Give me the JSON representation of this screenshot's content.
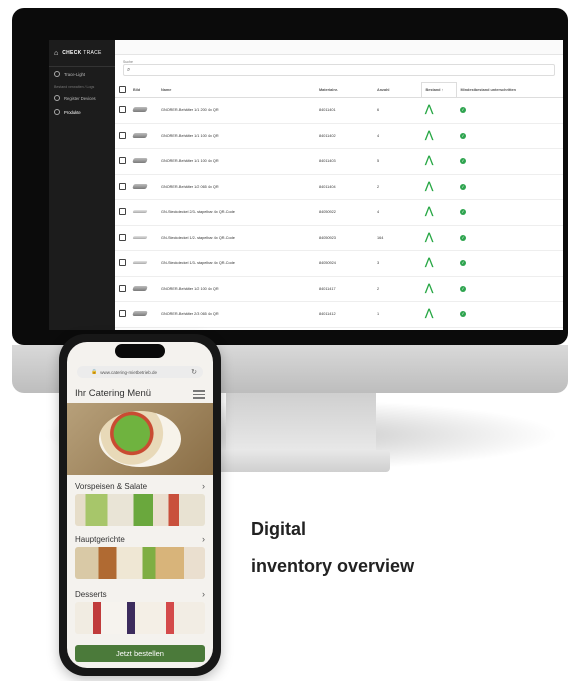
{
  "app": {
    "brand_prefix": "CHECK",
    "brand_suffix": "TRACE",
    "sidebar_items": [
      {
        "label": "Trace-Light"
      },
      {
        "label": "Register Devices"
      },
      {
        "label": "Produkte"
      }
    ],
    "sidebar_section": "Bestand verwalten / Logs",
    "search_label": "Suche",
    "table": {
      "columns": [
        "Bild",
        "Name",
        "Materialnr.",
        "Anzahl",
        "Bestand",
        "Mindestbestand unterschritten"
      ],
      "rows": [
        {
          "name": "GNORER-Behälter 1/1 200 4x QR",
          "material": "84011401",
          "count": "6"
        },
        {
          "name": "GNORER-Behälter 1/1 100 4x QR",
          "material": "84011402",
          "count": "4"
        },
        {
          "name": "GNORER-Behälter 1/1 100 4x QR",
          "material": "84011403",
          "count": "5"
        },
        {
          "name": "GNORER-Behälter 1/2 065 4x QR",
          "material": "84011404",
          "count": "2"
        },
        {
          "name": "GN-Steckdeckel 2/3- stapelbar 4x QR-Code",
          "material": "84050922",
          "count": "4"
        },
        {
          "name": "GN-Steckdeckel 1/2- stapelbar 4x QR-Code",
          "material": "84050923",
          "count": "164"
        },
        {
          "name": "GN-Steckdeckel 1/3- stapelbar 4x QR-Code",
          "material": "84050924",
          "count": "3"
        },
        {
          "name": "GNORER-Behälter 1/2 100 4x QR",
          "material": "84011417",
          "count": "2"
        },
        {
          "name": "GNORER-Behälter 2/3 065 4x QR",
          "material": "84011412",
          "count": "1"
        }
      ]
    }
  },
  "phone": {
    "url": "www.catering-mietbetrieb.de",
    "menu_title": "Ihr Catering Menü",
    "categories": [
      {
        "label": "Vorspeisen & Salate"
      },
      {
        "label": "Hauptgerichte"
      },
      {
        "label": "Desserts"
      }
    ],
    "order_button": "Jetzt bestellen"
  },
  "caption": {
    "line1": "Digital",
    "line2": "inventory overview"
  },
  "colors": {
    "accent_green": "#2ea44f",
    "order_button": "#4b7a3a",
    "sidebar_bg": "#1c1c1c"
  }
}
